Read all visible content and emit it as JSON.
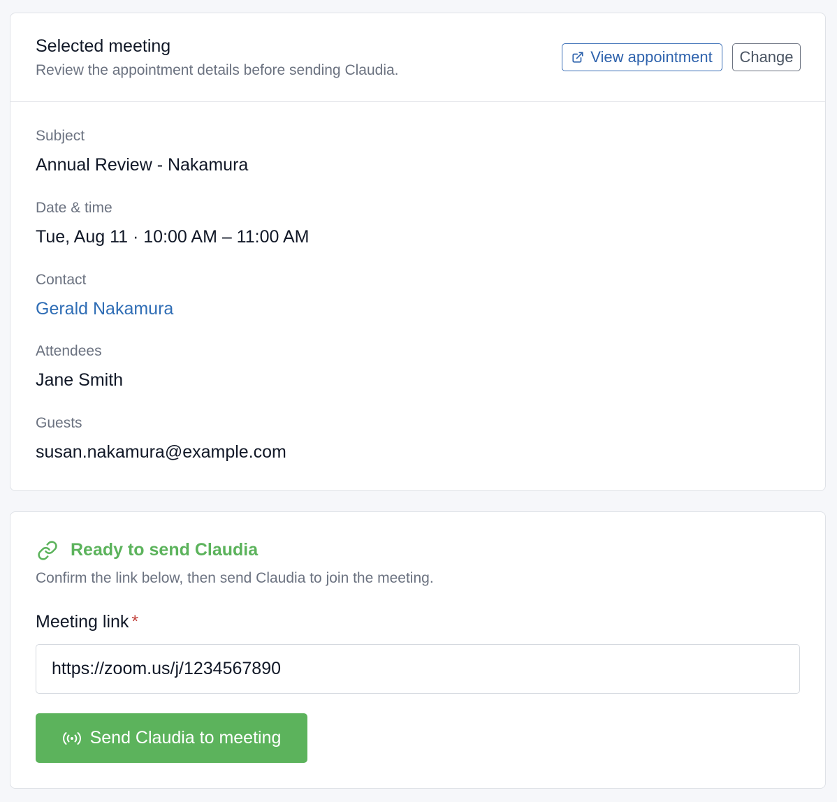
{
  "meeting_card": {
    "title": "Selected meeting",
    "subtitle": "Review the appointment details before sending Claudia.",
    "view_button_label": "View appointment",
    "change_button_label": "Change",
    "fields": [
      {
        "label": "Subject",
        "value": "Annual Review - Nakamura"
      },
      {
        "label": "Date & time",
        "value": "Tue, Aug 11 · 10:00 AM – 11:00 AM"
      },
      {
        "label": "Contact",
        "value": "Gerald Nakamura"
      },
      {
        "label": "Attendees",
        "value": "Jane Smith"
      },
      {
        "label": "Guests",
        "value": "susan.nakamura@example.com"
      }
    ]
  },
  "send_card": {
    "status_title": "Ready to send Claudia",
    "status_icon": "link-icon",
    "description": "Confirm the link below, then send Claudia to join the meeting.",
    "link_label": "Meeting link",
    "required_marker": "*",
    "link_value": "https://zoom.us/j/1234567890",
    "send_button_label": "Send Claudia to meeting",
    "send_button_icon": "broadcast-icon"
  },
  "colors": {
    "accent_blue": "#2f63ad",
    "success_green": "#5cb35c",
    "required_red": "#c2413b"
  }
}
